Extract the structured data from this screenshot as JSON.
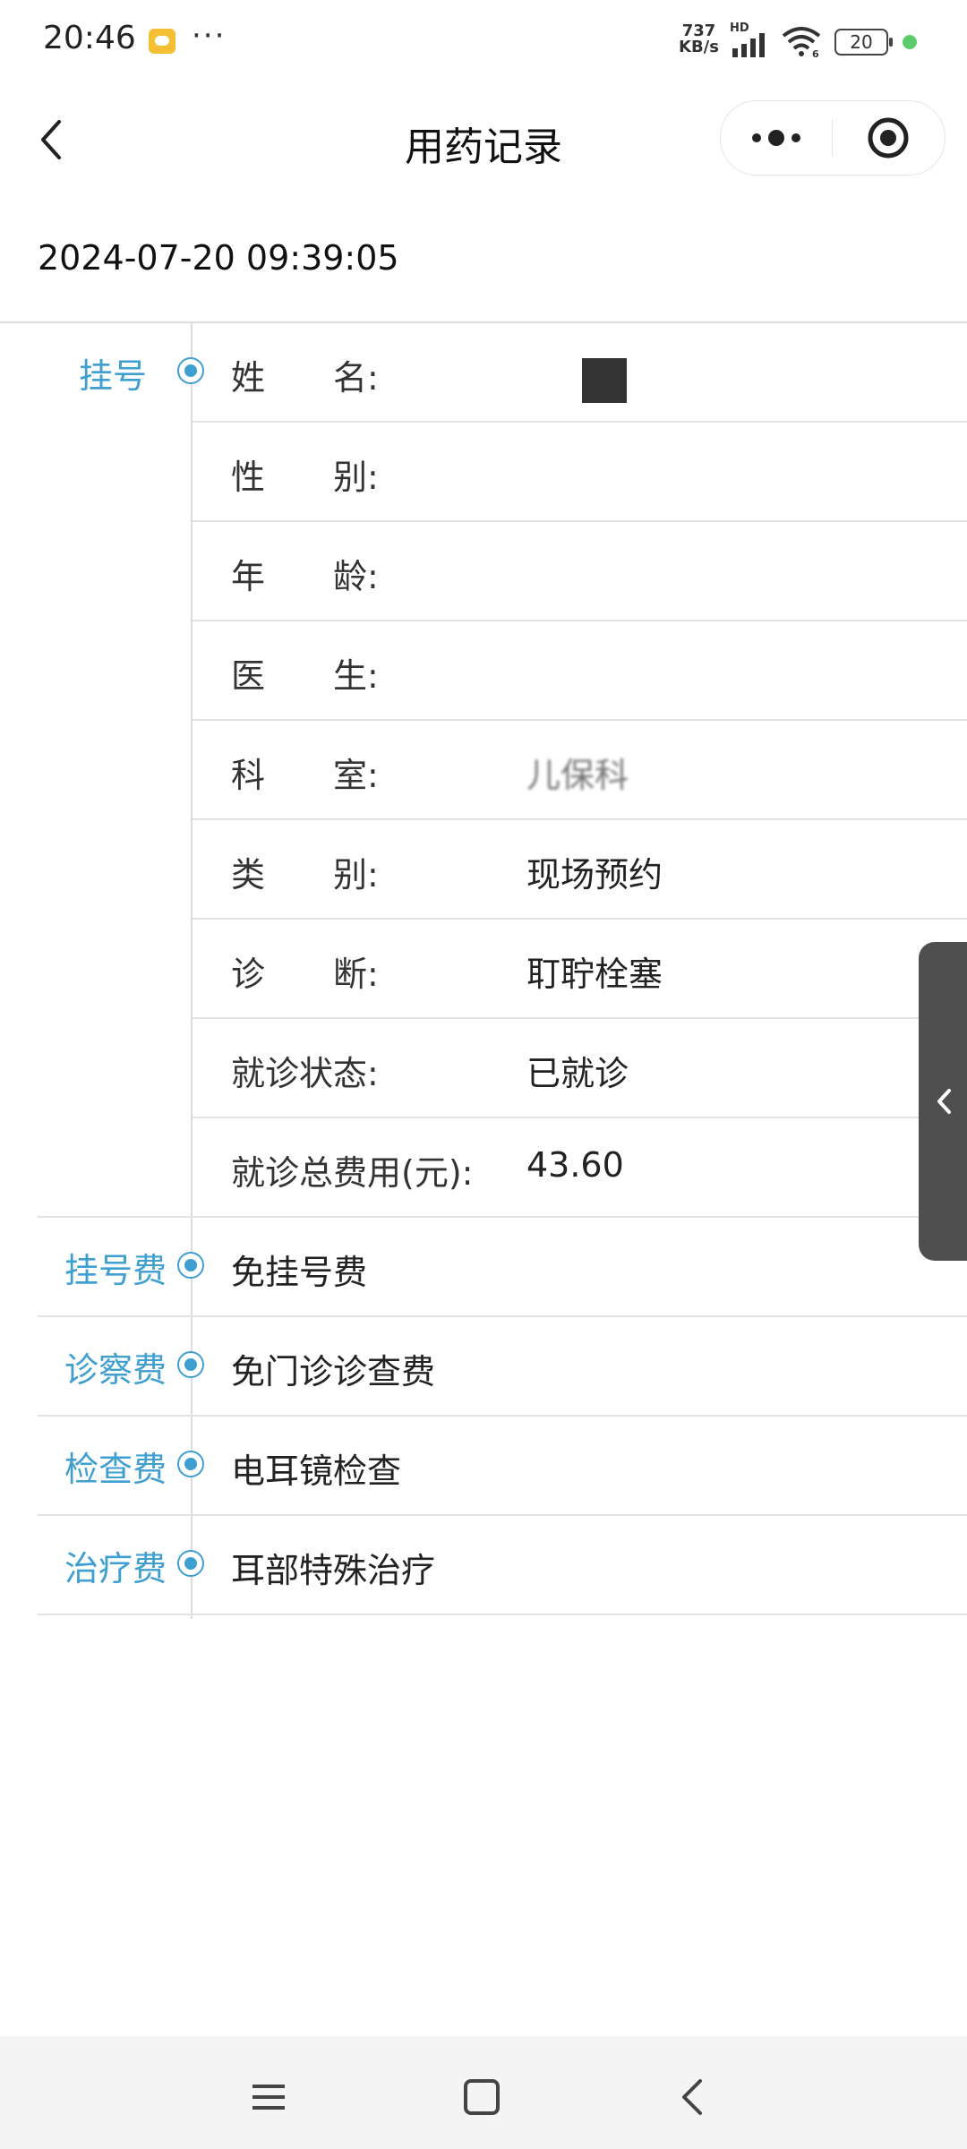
{
  "status_bar": {
    "time": "20:46",
    "dots": "···",
    "net_speed_value": "737",
    "net_speed_unit": "KB/s",
    "hd": "HD",
    "battery": "20"
  },
  "nav": {
    "title": "用药记录"
  },
  "record": {
    "datetime": "2024-07-20 09:39:05"
  },
  "registration": {
    "tag": "挂号",
    "fields": [
      {
        "label": "姓　　名:",
        "value": ""
      },
      {
        "label": "性　　别:",
        "value": ""
      },
      {
        "label": "年　　龄:",
        "value": ""
      },
      {
        "label": "医　　生:",
        "value": ""
      },
      {
        "label": "科　　室:",
        "value": "儿保科"
      },
      {
        "label": "类　　别:",
        "value": "现场预约"
      },
      {
        "label": "诊　　断:",
        "value": "耵聍栓塞"
      },
      {
        "label": "就诊状态:",
        "value": "已就诊"
      },
      {
        "label": "就诊总费用(元):",
        "value": "43.60"
      }
    ]
  },
  "fees": [
    {
      "tag": "挂号费",
      "item": "免挂号费"
    },
    {
      "tag": "诊察费",
      "item": "免门诊诊查费"
    },
    {
      "tag": "检查费",
      "item": "电耳镜检查"
    },
    {
      "tag": "治疗费",
      "item": "耳部特殊治疗"
    }
  ],
  "colors": {
    "accent": "#3f9fd0",
    "side_tab": "#4f4f4f"
  }
}
